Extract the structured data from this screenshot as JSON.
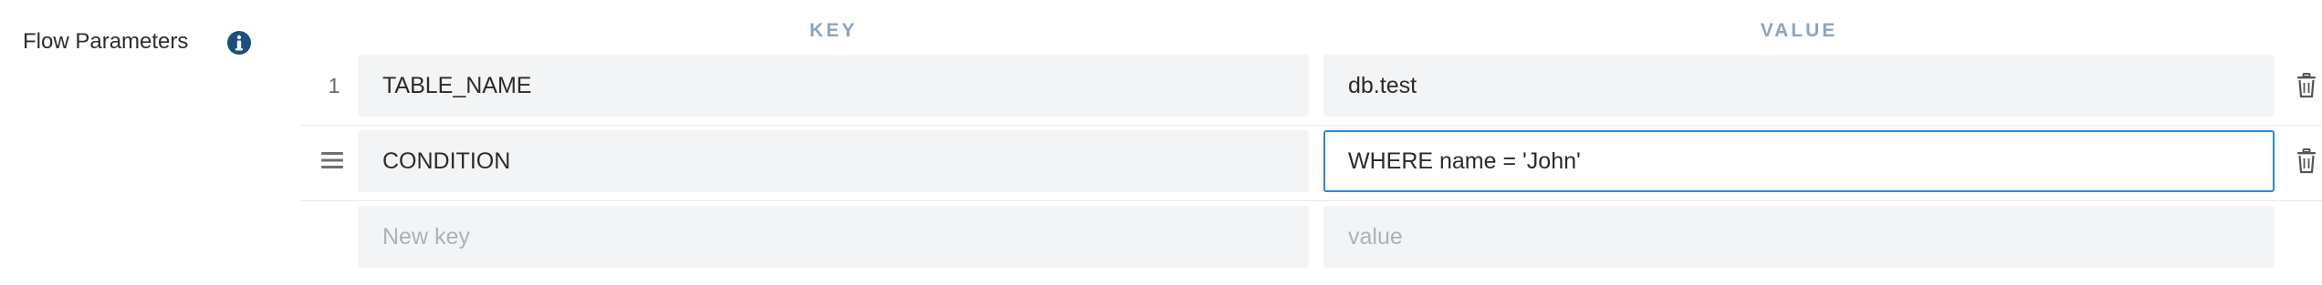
{
  "section": {
    "label": "Flow Parameters",
    "info_icon": "info-icon"
  },
  "columns": {
    "key": "KEY",
    "value": "VALUE"
  },
  "rows": [
    {
      "index": "1",
      "key": "TABLE_NAME",
      "value": "db.test",
      "handle": "row-number",
      "delete_icon": "trash-icon"
    },
    {
      "index": "",
      "key": "CONDITION",
      "value": "WHERE name = 'John'",
      "handle": "drag-handle-icon",
      "delete_icon": "trash-icon",
      "focused_field": "value"
    }
  ],
  "new_row": {
    "key_placeholder": "New key",
    "value_placeholder": "value"
  },
  "colors": {
    "focus_border": "#2e86d6",
    "field_bg": "#f3f4f5",
    "header_text": "#8fa3bf",
    "info_icon": "#1c4e80"
  }
}
